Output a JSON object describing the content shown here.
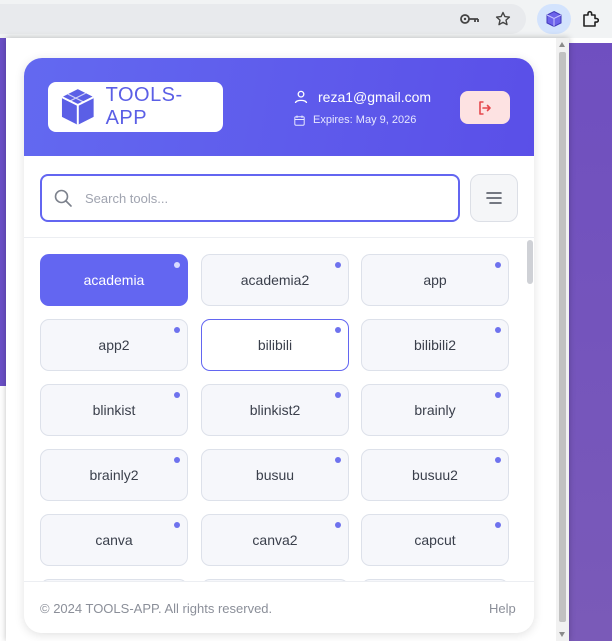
{
  "browser": {
    "icons": [
      "key-icon",
      "star-icon",
      "extension-cube-icon",
      "puzzle-icon"
    ]
  },
  "header": {
    "logo_text": "TOOLS-APP",
    "email": "reza1@gmail.com",
    "expires": "Expires: May 9, 2026"
  },
  "search": {
    "placeholder": "Search tools..."
  },
  "tools": [
    {
      "label": "academia",
      "state": "active"
    },
    {
      "label": "academia2",
      "state": "normal"
    },
    {
      "label": "app",
      "state": "normal"
    },
    {
      "label": "app2",
      "state": "normal"
    },
    {
      "label": "bilibili",
      "state": "hover"
    },
    {
      "label": "bilibili2",
      "state": "normal"
    },
    {
      "label": "blinkist",
      "state": "normal"
    },
    {
      "label": "blinkist2",
      "state": "normal"
    },
    {
      "label": "brainly",
      "state": "normal"
    },
    {
      "label": "brainly2",
      "state": "normal"
    },
    {
      "label": "busuu",
      "state": "normal"
    },
    {
      "label": "busuu2",
      "state": "normal"
    },
    {
      "label": "canva",
      "state": "normal"
    },
    {
      "label": "canva2",
      "state": "normal"
    },
    {
      "label": "capcut",
      "state": "normal"
    }
  ],
  "footer": {
    "copyright": "© 2024 TOOLS-APP. All rights reserved.",
    "help": "Help"
  },
  "colors": {
    "accent": "#6366f1",
    "header_gradient": [
      "#6369f0",
      "#5a4fe8"
    ],
    "logout_bg": "#fde2e2",
    "logout_icon": "#e5484d"
  }
}
